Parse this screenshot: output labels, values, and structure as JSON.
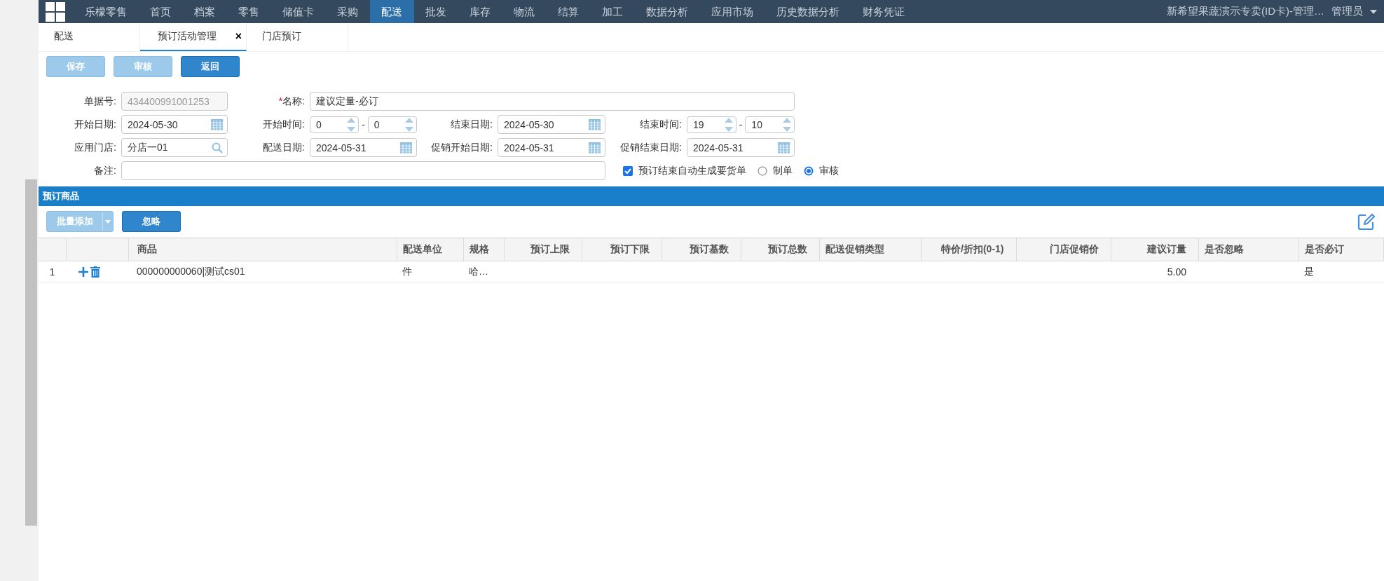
{
  "nav": {
    "brand": "乐檬零售",
    "items": [
      {
        "label": "首页",
        "selected": false
      },
      {
        "label": "档案",
        "selected": false
      },
      {
        "label": "零售",
        "selected": false
      },
      {
        "label": "储值卡",
        "selected": false
      },
      {
        "label": "采购",
        "selected": false
      },
      {
        "label": "配送",
        "selected": true
      },
      {
        "label": "批发",
        "selected": false
      },
      {
        "label": "库存",
        "selected": false
      },
      {
        "label": "物流",
        "selected": false
      },
      {
        "label": "结算",
        "selected": false
      },
      {
        "label": "加工",
        "selected": false
      },
      {
        "label": "数据分析",
        "selected": false
      },
      {
        "label": "应用市场",
        "selected": false
      },
      {
        "label": "历史数据分析",
        "selected": false
      },
      {
        "label": "财务凭证",
        "selected": false
      }
    ],
    "account": "新希望果蔬演示专卖(ID卡)-管理…",
    "user": "管理员"
  },
  "tabs": [
    {
      "label": "配送",
      "selected": false
    },
    {
      "label": "预订活动管理",
      "selected": true,
      "close": "×"
    },
    {
      "label": "门店预订",
      "selected": false
    }
  ],
  "actions": [
    {
      "label": "保存",
      "disabled": true
    },
    {
      "label": "审核",
      "disabled": true
    },
    {
      "label": "返回",
      "disabled": false
    }
  ],
  "form": {
    "rows": [
      [
        {
          "label": "单据号:",
          "kind": "readonly",
          "value": "434400991001253"
        },
        {
          "label": "名称:",
          "required": "*",
          "kind": "wide",
          "value": "建议定量-必订"
        }
      ],
      [
        {
          "label": "开始日期:",
          "kind": "date",
          "value": "2024-05-30"
        },
        {
          "label": "开始时间:",
          "kind": "time",
          "values": [
            "0",
            "0"
          ],
          "separator": "-"
        },
        {
          "label": "结束日期:",
          "kind": "date",
          "value": "2024-05-30"
        },
        {
          "label": "结束时间:",
          "kind": "time",
          "values": [
            "19",
            "10"
          ],
          "separator": "-"
        }
      ],
      [
        {
          "label": "应用门店:",
          "kind": "search",
          "value": "分店一01"
        },
        {
          "label": "配送日期:",
          "kind": "date",
          "value": "2024-05-31"
        },
        {
          "label": "促销开始日期:",
          "kind": "date",
          "value": "2024-05-31"
        },
        {
          "label": "促销结束日期:",
          "kind": "date",
          "value": "2024-05-31"
        }
      ],
      [
        {
          "label": "备注:",
          "kind": "remark"
        }
      ]
    ],
    "auto_order": {
      "label": "预订结束自动生成要货单",
      "checked": true
    },
    "mode": [
      {
        "label": "制单",
        "selected": false
      },
      {
        "label": "审核",
        "selected": true
      }
    ]
  },
  "section": {
    "title": "预订商品",
    "toolbar": [
      {
        "label": "批量添加",
        "kind": "split",
        "disabled": true
      },
      {
        "label": "忽略",
        "kind": "plain",
        "disabled": false
      }
    ]
  },
  "table": {
    "columns": [
      "商品",
      "配送单位",
      "规格",
      "预订上限",
      "预订下限",
      "预订基数",
      "预订总数",
      "配送促销类型",
      "特价/折扣(0-1)",
      "门店促销价",
      "建议订量",
      "是否忽略",
      "是否必订"
    ],
    "rows": [
      {
        "number": "1",
        "cells": [
          "000000000060|测试cs01",
          "件",
          "哈…",
          null,
          null,
          null,
          null,
          null,
          null,
          null,
          "5.00",
          null,
          "是"
        ]
      }
    ]
  }
}
